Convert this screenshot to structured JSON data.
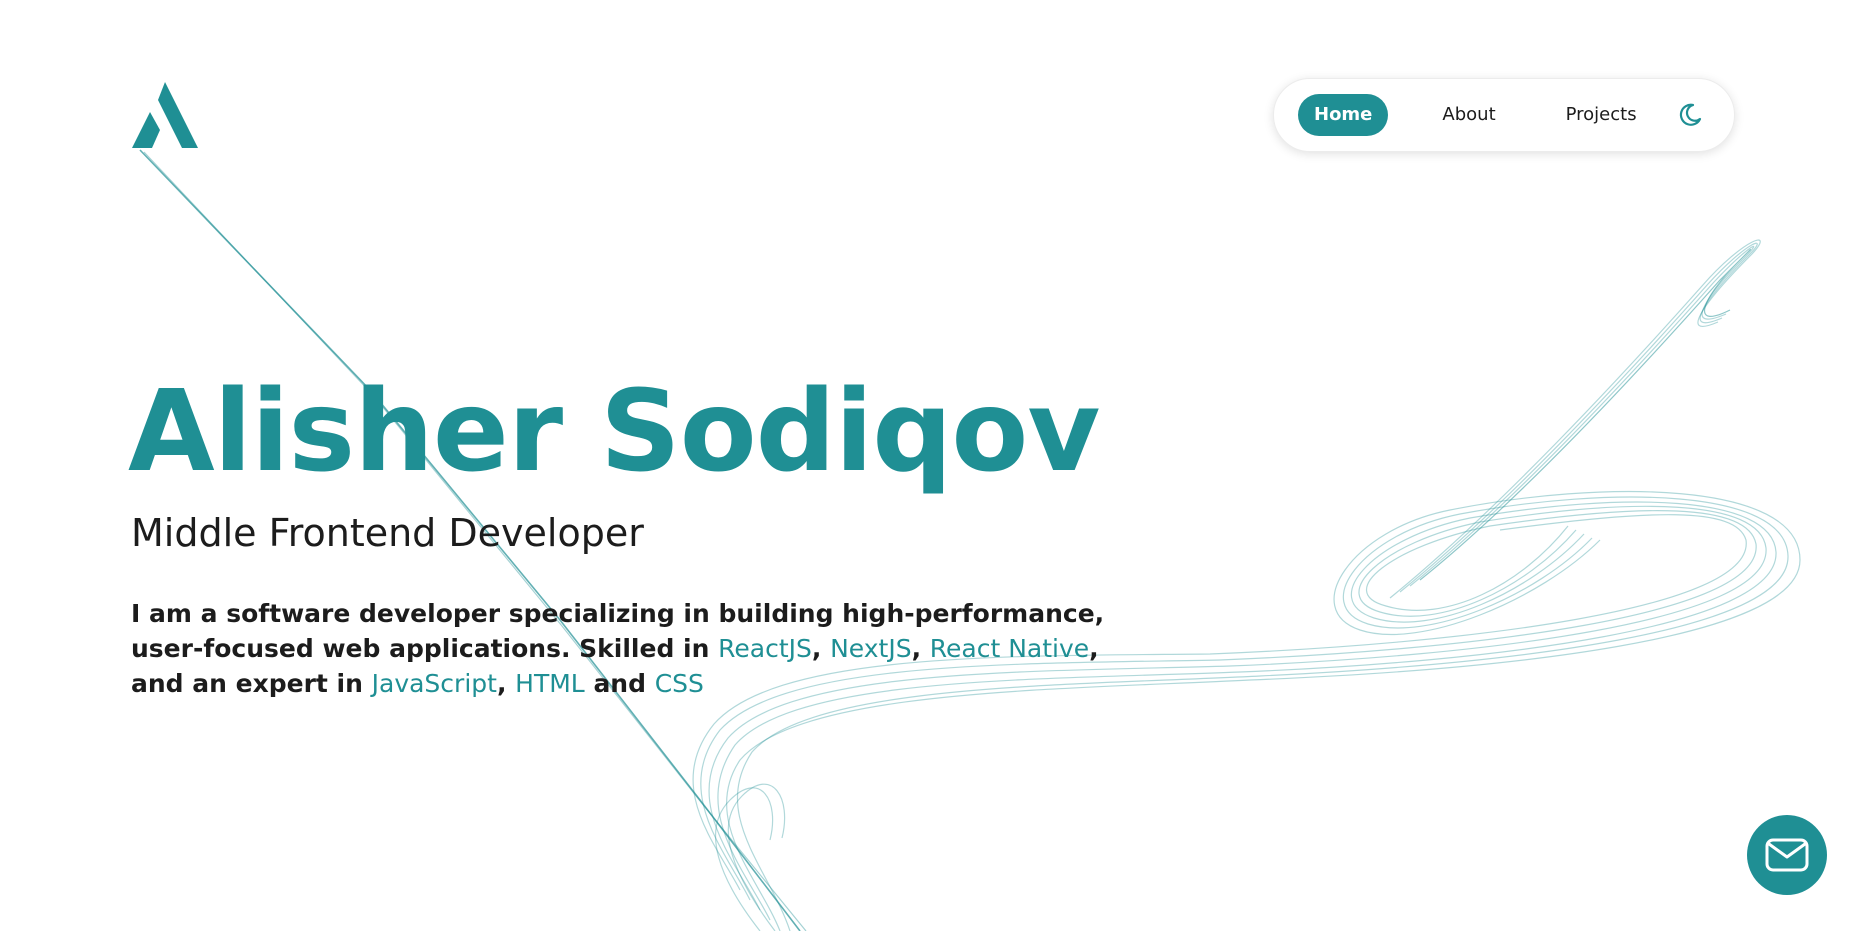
{
  "brand": {
    "logo_icon": "a-letter-logo-icon",
    "accent_color": "#1f8f94"
  },
  "nav": {
    "items": [
      {
        "label": "Home",
        "active": true
      },
      {
        "label": "About",
        "active": false
      },
      {
        "label": "Projects",
        "active": false
      }
    ],
    "theme_toggle_icon": "moon-icon"
  },
  "hero": {
    "name": "Alisher Sodiqov",
    "role": "Middle Frontend Developer",
    "desc_part1": "I am a software developer specializing in building high-performance, user-focused web applications. Skilled in ",
    "skill_react": "ReactJS",
    "sep1": ", ",
    "skill_next": "NextJS",
    "sep2": ", ",
    "skill_rn": "React Native",
    "desc_part2": ", and an expert in ",
    "skill_js": "JavaScript",
    "sep3": ", ",
    "skill_html": "HTML",
    "desc_and": " and ",
    "skill_css": "CSS"
  },
  "contact": {
    "icon": "mail-icon"
  }
}
